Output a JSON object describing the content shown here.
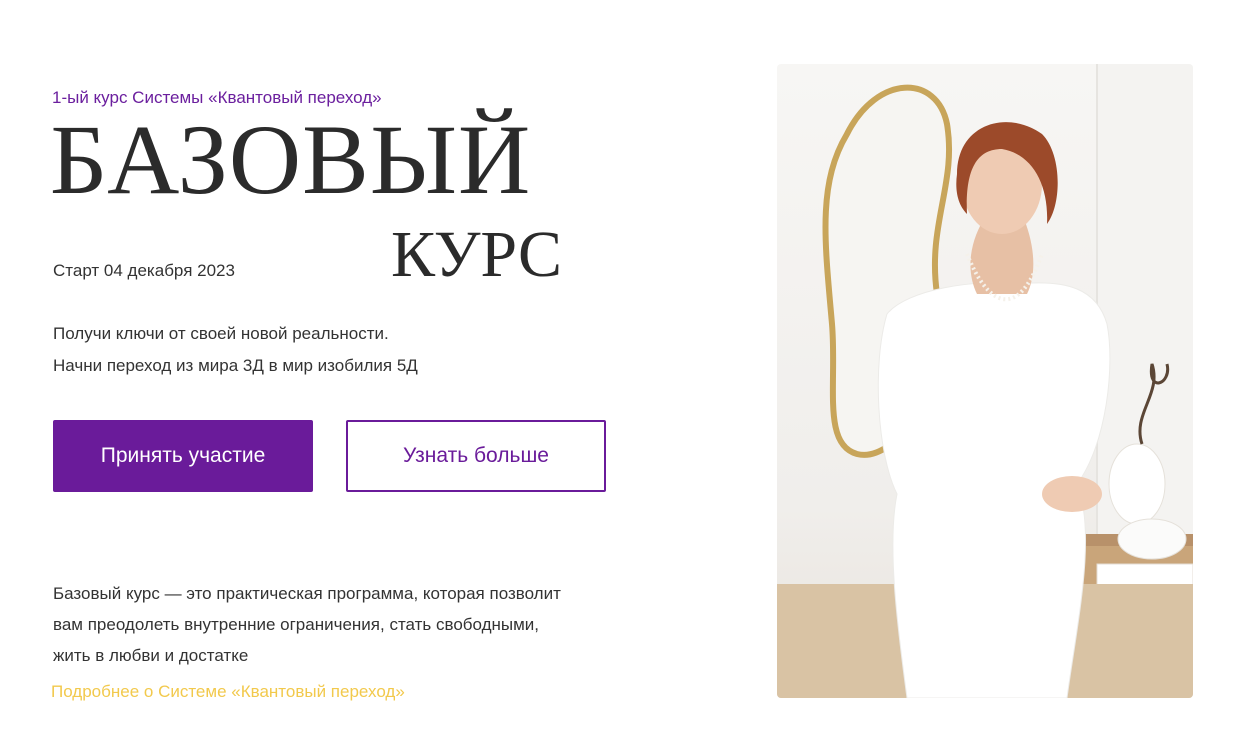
{
  "hero": {
    "subtitle": "1-ый курс Системы «Квантовый переход»",
    "title_line1": "БАЗОВЫЙ",
    "title_line2": "КУРС",
    "start_date": "Старт 04 декабря 2023",
    "tagline_line1": "Получи ключи от своей новой реальности.",
    "tagline_line2": "Начни переход из мира 3Д в мир изобилия 5Д",
    "primary_button": "Принять участие",
    "secondary_button": "Узнать больше",
    "description_line1": "Базовый курс — это практическая программа, которая позволит",
    "description_line2": "вам преодолеть внутренние ограничения, стать свободными,",
    "description_line3": "жить в любви и достатке",
    "more_link": "Подробнее о Системе «Квантовый переход»"
  },
  "colors": {
    "accent": "#6a1b9a",
    "link": "#f2c94c",
    "text": "#333333"
  },
  "photo": {
    "icon": "portrait-photo"
  }
}
